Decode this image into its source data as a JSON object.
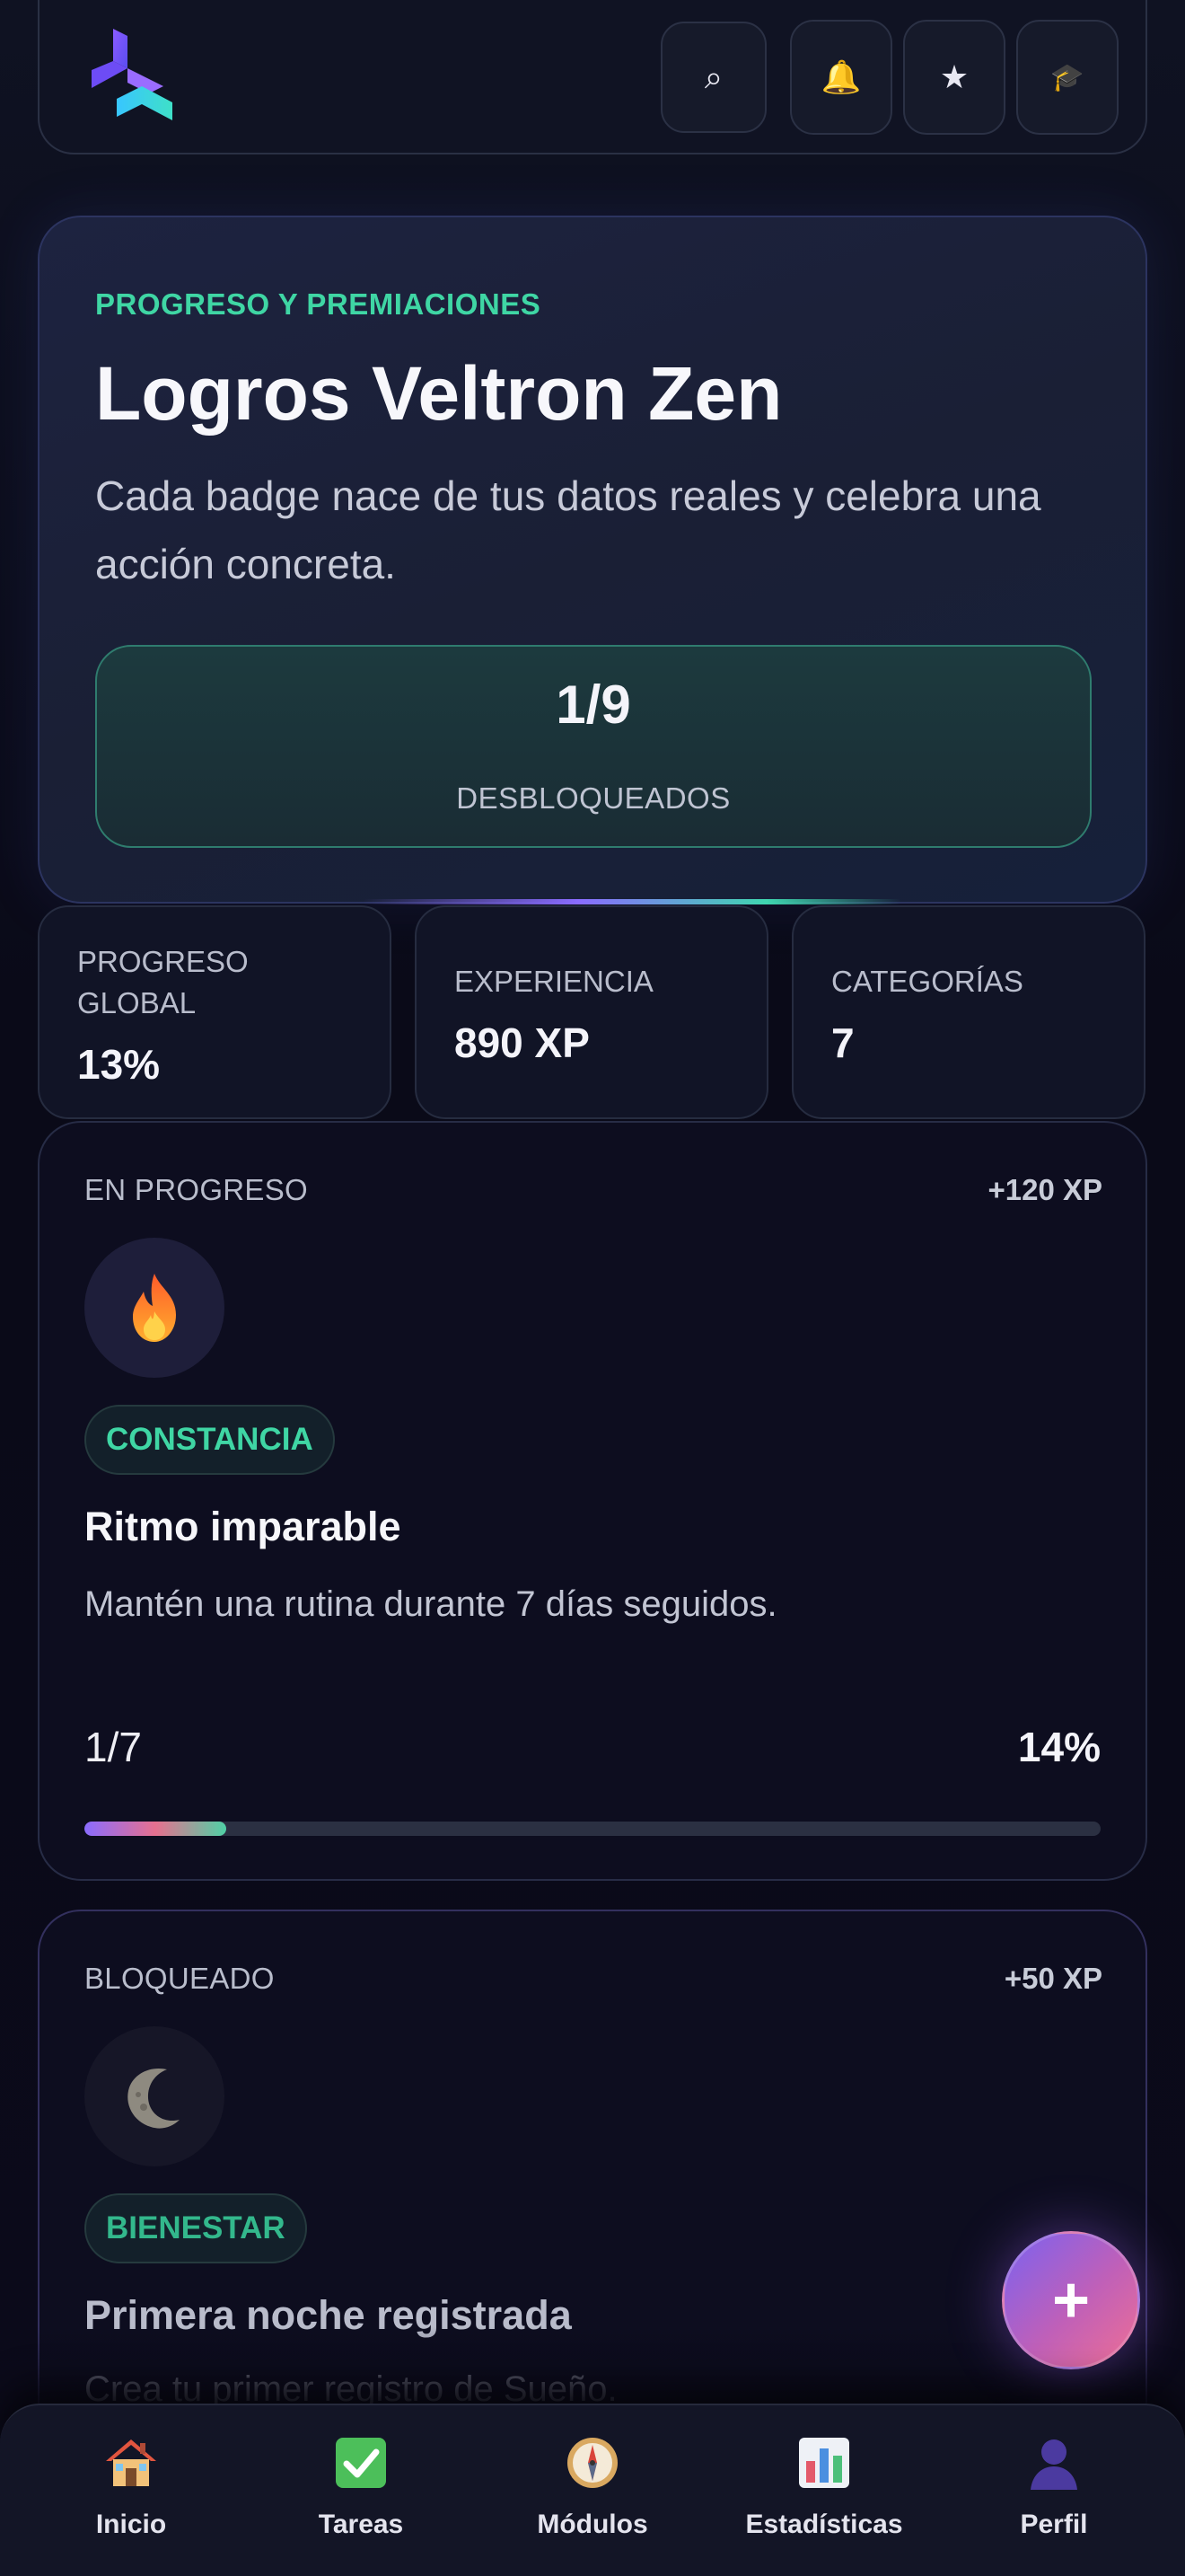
{
  "header": {
    "buttons": [
      {
        "icon": "search-icon",
        "glyph": "⌕"
      },
      {
        "icon": "bell-icon",
        "glyph": "🔔"
      },
      {
        "icon": "star-icon",
        "glyph": "★"
      },
      {
        "icon": "graduation-cap-icon",
        "glyph": "🎓"
      }
    ]
  },
  "hero": {
    "eyebrow": "PROGRESO Y PREMIACIONES",
    "title": "Logros Veltron Zen",
    "subtitle": "Cada badge nace de tus datos reales y celebra una acción concreta.",
    "unlocked_count": "1/9",
    "unlocked_label": "DESBLOQUEADOS"
  },
  "stats": [
    {
      "label": "PROGRESO GLOBAL",
      "value": "13%"
    },
    {
      "label": "EXPERIENCIA",
      "value": "890 XP"
    },
    {
      "label": "CATEGORÍAS",
      "value": "7"
    }
  ],
  "achievements": [
    {
      "status": "EN PROGRESO",
      "xp": "+120 XP",
      "icon": "fire-icon",
      "category": "CONSTANCIA",
      "title": "Ritmo imparable",
      "description": "Mantén una rutina durante 7 días seguidos.",
      "progress_text": "1/7",
      "progress_percent": "14%",
      "progress_fraction": 0.14
    },
    {
      "status": "BLOQUEADO",
      "xp": "+50 XP",
      "icon": "moon-icon",
      "category": "BIENESTAR",
      "title": "Primera noche registrada",
      "description": "Crea tu primer registro de Sueño."
    }
  ],
  "fab": {
    "label": "+"
  },
  "bottom_nav": [
    {
      "label": "Inicio",
      "icon": "home-icon"
    },
    {
      "label": "Tareas",
      "icon": "checkbox-icon"
    },
    {
      "label": "Módulos",
      "icon": "compass-icon"
    },
    {
      "label": "Estadísticas",
      "icon": "bar-chart-icon"
    },
    {
      "label": "Perfil",
      "icon": "user-icon"
    }
  ],
  "colors": {
    "accent_green": "#3fd6a4",
    "accent_purple": "#8a6cff",
    "accent_pink": "#ef6f94",
    "background": "#0b0b1a"
  }
}
